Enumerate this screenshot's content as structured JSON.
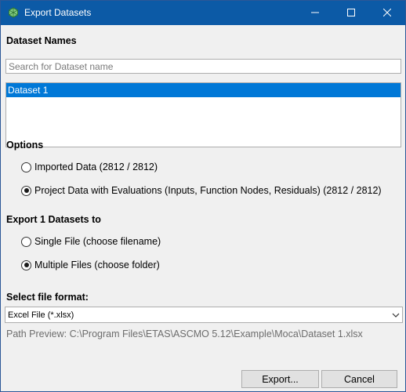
{
  "window": {
    "title": "Export Datasets",
    "app_icon": "etas-ascmo-icon"
  },
  "titlebar": {
    "minimize_icon": "minimize-icon",
    "maximize_icon": "maximize-icon",
    "close_icon": "close-icon"
  },
  "dataset_names": {
    "label": "Dataset Names",
    "search_placeholder": "Search for Dataset name",
    "search_value": "",
    "items": [
      {
        "label": "Dataset 1",
        "selected": true
      }
    ]
  },
  "options": {
    "label": "Options",
    "choices": [
      {
        "label": "Imported Data (2812 / 2812)",
        "checked": false
      },
      {
        "label": "Project Data with Evaluations (Inputs, Function Nodes, Residuals) (2812 / 2812)",
        "checked": true
      }
    ]
  },
  "export_to": {
    "label": "Export 1 Datasets to",
    "choices": [
      {
        "label": "Single File (choose filename)",
        "checked": false
      },
      {
        "label": "Multiple Files (choose folder)",
        "checked": true
      }
    ]
  },
  "file_format": {
    "label": "Select file format:",
    "selected": "Excel File (*.xlsx)"
  },
  "path_preview": "Path Preview: C:\\Program Files\\ETAS\\ASCMO 5.12\\Example\\Moca\\Dataset 1.xlsx",
  "buttons": {
    "export": "Export...",
    "cancel": "Cancel"
  }
}
